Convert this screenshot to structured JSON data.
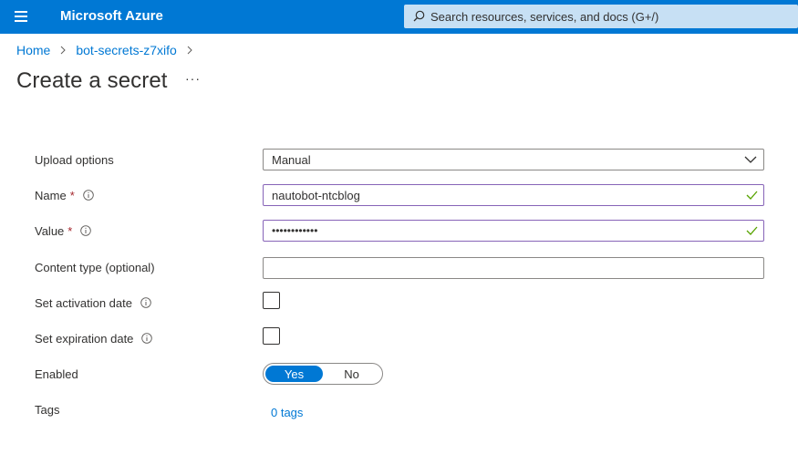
{
  "header": {
    "brand": "Microsoft Azure",
    "search_placeholder": "Search resources, services, and docs (G+/)"
  },
  "breadcrumb": {
    "items": [
      "Home",
      "bot-secrets-z7xifo"
    ]
  },
  "page": {
    "title": "Create a secret",
    "more": "···"
  },
  "form": {
    "upload_options": {
      "label": "Upload options",
      "value": "Manual"
    },
    "name": {
      "label": "Name",
      "required_mark": "*",
      "value": "nautobot-ntcblog",
      "valid": true
    },
    "value": {
      "label": "Value",
      "required_mark": "*",
      "value": "••••••••••••",
      "valid": true
    },
    "content_type": {
      "label": "Content type (optional)",
      "value": ""
    },
    "activation_date": {
      "label": "Set activation date",
      "checked": false
    },
    "expiration_date": {
      "label": "Set expiration date",
      "checked": false
    },
    "enabled": {
      "label": "Enabled",
      "options": [
        "Yes",
        "No"
      ],
      "selected": "Yes"
    },
    "tags": {
      "label": "Tags",
      "link": "0 tags"
    }
  },
  "colors": {
    "accent": "#0078d4",
    "search_bg": "#c7e0f4",
    "required": "#a4262c",
    "valid_border": "#8764b8",
    "valid_check": "#57a300"
  },
  "icons": [
    "hamburger-icon",
    "search-icon",
    "chevron-right-icon",
    "chevron-down-icon",
    "info-icon",
    "checkmark-icon"
  ]
}
